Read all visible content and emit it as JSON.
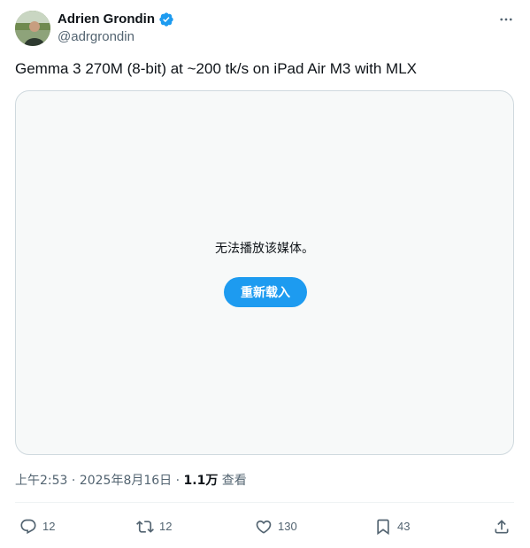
{
  "author": {
    "display_name": "Adrien Grondin",
    "handle": "@adrgrondin",
    "verified": true
  },
  "tweet": {
    "text": "Gemma 3 270M (8-bit) at ~200 tk/s on iPad Air M3 with MLX"
  },
  "media": {
    "error_message": "无法播放该媒体。",
    "reload_label": "重新载入"
  },
  "meta": {
    "time": "上午2:53",
    "separator": " · ",
    "date": "2025年8月16日",
    "views_count": "1.1万",
    "views_label": " 查看"
  },
  "actions": {
    "replies": "12",
    "retweets": "12",
    "likes": "130",
    "bookmarks": "43"
  },
  "colors": {
    "accent": "#1d9bf0",
    "secondary_text": "#536471",
    "border": "#cfd9de"
  },
  "icons": [
    "verified-badge-icon",
    "more-icon",
    "reply-icon",
    "retweet-icon",
    "like-icon",
    "bookmark-icon",
    "share-icon"
  ]
}
